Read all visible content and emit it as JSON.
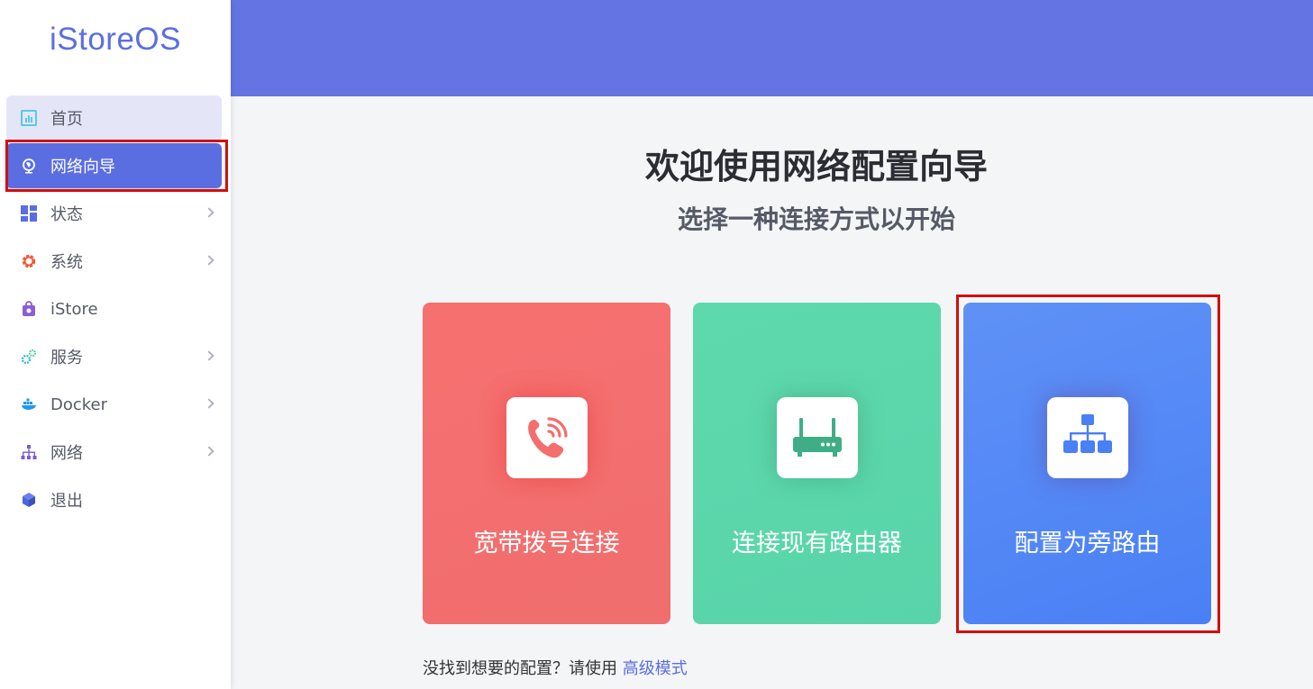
{
  "app": {
    "logo": "iStoreOS"
  },
  "sidebar": {
    "items": [
      {
        "label": "首页",
        "icon": "chart-icon",
        "has_submenu": false
      },
      {
        "label": "网络向导",
        "icon": "globe-icon",
        "has_submenu": false,
        "active": true
      },
      {
        "label": "状态",
        "icon": "dashboard-icon",
        "has_submenu": true
      },
      {
        "label": "系统",
        "icon": "gear-icon",
        "has_submenu": true
      },
      {
        "label": "iStore",
        "icon": "store-bag-icon",
        "has_submenu": false
      },
      {
        "label": "服务",
        "icon": "cogs-icon",
        "has_submenu": true
      },
      {
        "label": "Docker",
        "icon": "docker-icon",
        "has_submenu": true
      },
      {
        "label": "网络",
        "icon": "network-icon",
        "has_submenu": true
      },
      {
        "label": "退出",
        "icon": "cube-icon",
        "has_submenu": false
      }
    ]
  },
  "main": {
    "title": "欢迎使用网络配置向导",
    "subtitle": "选择一种连接方式以开始",
    "cards": [
      {
        "label": "宽带拨号连接",
        "icon": "phone-icon",
        "color": "#f46e6e"
      },
      {
        "label": "连接现有路由器",
        "icon": "router-icon",
        "color": "#5cd7ab"
      },
      {
        "label": "配置为旁路由",
        "icon": "sitemap-icon",
        "color": "#5588f5"
      }
    ],
    "footer_prefix": "没找到想要的配置？请使用",
    "footer_link": "高级模式"
  },
  "colors": {
    "accent": "#5b6ee1",
    "topbar": "#6475e3",
    "highlight": "#d10f0f"
  }
}
